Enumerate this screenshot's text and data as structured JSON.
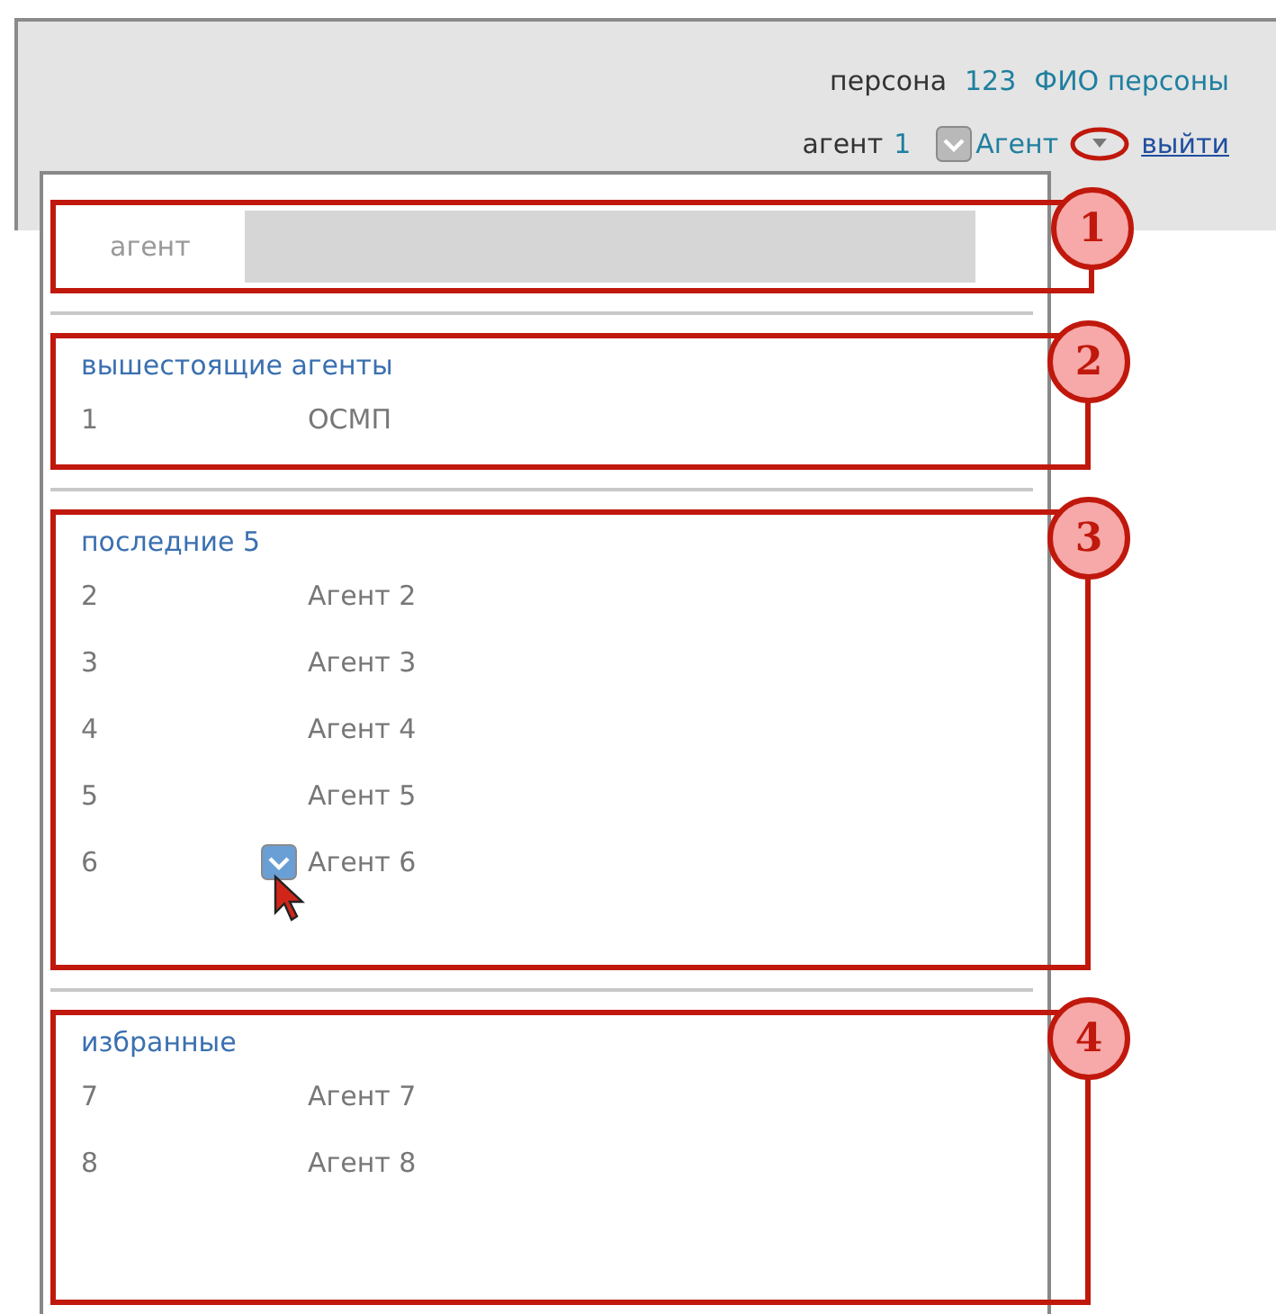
{
  "header": {
    "person_label": "персона",
    "person_id": "123",
    "person_name": "ФИО персоны",
    "agent_label": "агент",
    "agent_id": "1",
    "agent_name": "Агент",
    "logout": "выйти"
  },
  "dropdown": {
    "search": {
      "label": "агент",
      "callout": "1"
    },
    "sections": [
      {
        "title": "вышестоящие агенты",
        "callout": "2",
        "rows": [
          {
            "id": "1",
            "name": "ОСМП",
            "hovered": false
          }
        ]
      },
      {
        "title": "последние 5",
        "callout": "3",
        "rows": [
          {
            "id": "2",
            "name": "Агент 2",
            "hovered": false
          },
          {
            "id": "3",
            "name": "Агент 3",
            "hovered": false
          },
          {
            "id": "4",
            "name": "Агент 4",
            "hovered": false
          },
          {
            "id": "5",
            "name": "Агент 5",
            "hovered": false
          },
          {
            "id": "6",
            "name": "Агент 6",
            "hovered": true
          }
        ]
      },
      {
        "title": "избранные",
        "callout": "4",
        "rows": [
          {
            "id": "7",
            "name": "Агент 7",
            "hovered": false
          },
          {
            "id": "8",
            "name": "Агент 8",
            "hovered": false
          }
        ]
      }
    ]
  }
}
